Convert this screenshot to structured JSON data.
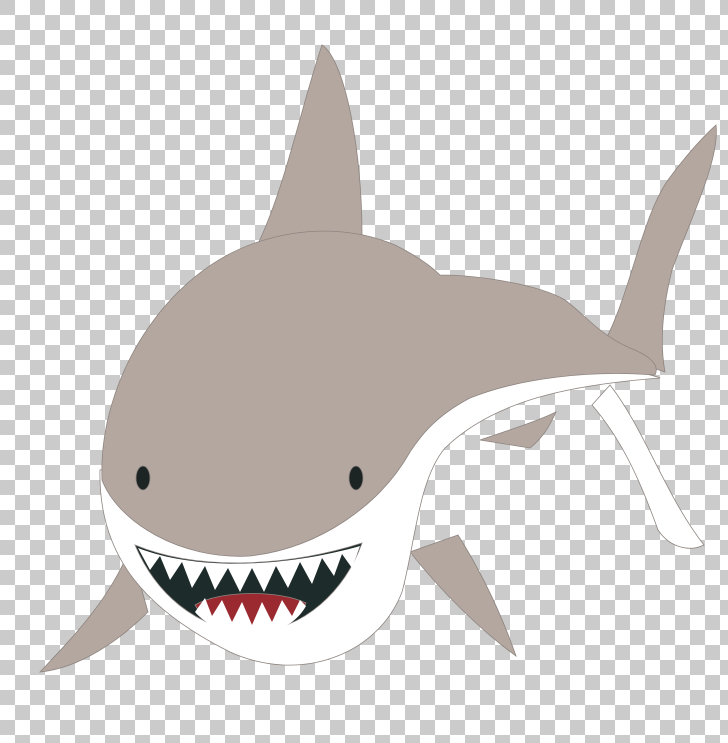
{
  "image": {
    "subject": "shark",
    "colors": {
      "body": "#b4a7a0",
      "belly": "#ffffff",
      "outline": "#8e8580",
      "mouth": "#1d2b2b",
      "tongue": "#9a2a30",
      "eye": "#1c2424",
      "checker_dark": "#cbcbcb",
      "checker_light": "#ffffff"
    }
  }
}
